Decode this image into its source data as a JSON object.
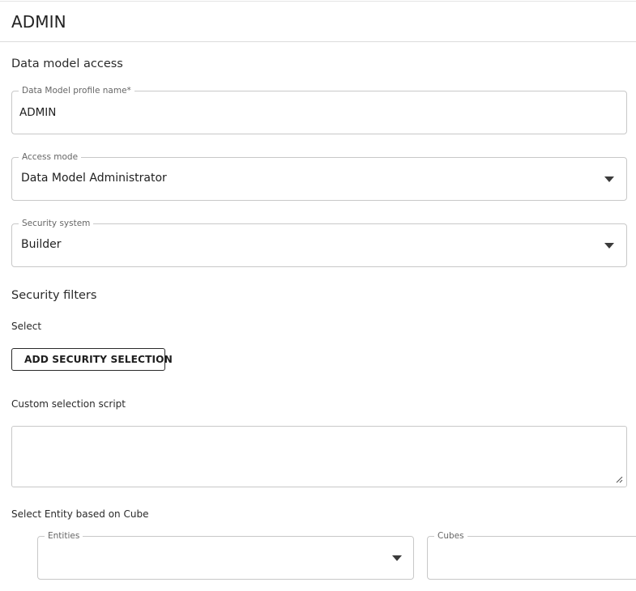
{
  "header": {
    "title": "ADMIN"
  },
  "section_data_model_access": {
    "title": "Data model access"
  },
  "profile_name_field": {
    "label": "Data Model profile name*",
    "value": "ADMIN"
  },
  "access_mode_field": {
    "label": "Access mode",
    "value": "Data Model Administrator",
    "icon": "chevron-down-icon"
  },
  "security_system_field": {
    "label": "Security system",
    "value": "Builder",
    "icon": "chevron-down-icon"
  },
  "section_security_filters": {
    "title": "Security filters"
  },
  "select_label": "Select",
  "add_security_selection_button": {
    "label": "ADD SECURITY SELECTION",
    "icon": "tree-selection-icon"
  },
  "custom_script": {
    "label": "Custom selection script",
    "value": ""
  },
  "entity_cube": {
    "label": "Select Entity based on Cube"
  },
  "entities_field": {
    "label": "Entities",
    "value": "",
    "icon": "chevron-down-icon"
  },
  "cubes_field": {
    "label": "Cubes",
    "value": ""
  },
  "colors": {
    "border": "#c8c8c8",
    "text": "#212121",
    "label": "#666666"
  }
}
